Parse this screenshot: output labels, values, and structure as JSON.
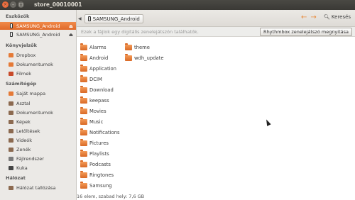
{
  "window": {
    "title": "store_00010001"
  },
  "toolbar": {
    "path_label": "SAMSUNG_Android",
    "search_label": "Keresés"
  },
  "sidebar": {
    "sections": [
      {
        "heading": "Eszközök",
        "items": [
          {
            "label": "SAMSUNG_Android",
            "icon": "phone-icon",
            "active": true
          },
          {
            "label": "SAMSUNG_Android",
            "icon": "phone-icon",
            "active": false
          }
        ]
      },
      {
        "heading": "Könyvjelzők",
        "items": [
          {
            "label": "Dropbox",
            "icon": "folder-icon"
          },
          {
            "label": "Dokumentumok",
            "icon": "folder-icon"
          },
          {
            "label": "Filmek",
            "icon": "folder-icon"
          }
        ]
      },
      {
        "heading": "Számítógép",
        "items": [
          {
            "label": "Saját mappa",
            "icon": "home-icon"
          },
          {
            "label": "Asztal",
            "icon": "desktop-icon"
          },
          {
            "label": "Dokumentumok",
            "icon": "documents-icon"
          },
          {
            "label": "Képek",
            "icon": "pictures-icon"
          },
          {
            "label": "Letöltések",
            "icon": "downloads-icon"
          },
          {
            "label": "Videók",
            "icon": "videos-icon"
          },
          {
            "label": "Zenék",
            "icon": "music-icon"
          },
          {
            "label": "Fájlrendszer",
            "icon": "filesystem-icon"
          },
          {
            "label": "Kuka",
            "icon": "trash-icon"
          }
        ]
      },
      {
        "heading": "Hálózat",
        "items": [
          {
            "label": "Hálózat tallózása",
            "icon": "network-icon"
          }
        ]
      }
    ]
  },
  "infobar": {
    "message": "Ezek a fájlok egy digitális zenelejátszón találhatók.",
    "button_label": "Rhythmbox zenelejátszó megnyitása"
  },
  "files": [
    "Alarms",
    "Android",
    "Application",
    "DCIM",
    "Download",
    "keepass",
    "Movies",
    "Music",
    "Notifications",
    "Pictures",
    "Playlists",
    "Podcasts",
    "Ringtones",
    "Samsung",
    "theme",
    "wdh_update"
  ],
  "status": "16 elem, szabad hely: 7,6 GB"
}
